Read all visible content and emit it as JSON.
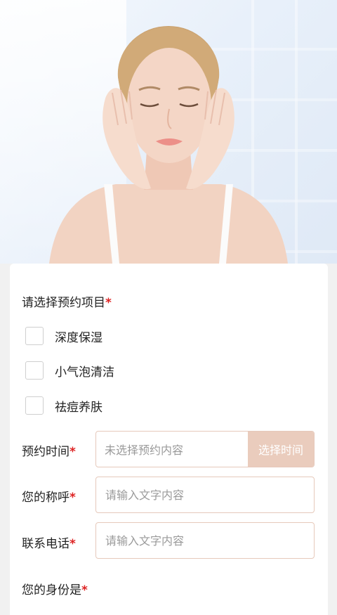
{
  "form": {
    "project_section_title": "请选择预约项目",
    "required_mark": "*",
    "options": [
      {
        "label": "深度保湿"
      },
      {
        "label": "小气泡清洁"
      },
      {
        "label": "祛痘养肤"
      }
    ],
    "time": {
      "label": "预约时间",
      "value_placeholder": "未选择预约内容",
      "pick_button": "选择时间"
    },
    "name": {
      "label": "您的称呼",
      "placeholder": "请输入文字内容"
    },
    "phone": {
      "label": "联系电话",
      "placeholder": "请输入文字内容"
    },
    "identity": {
      "label": "您的身份是"
    }
  },
  "colors": {
    "required": "#dd2222",
    "accent_field_border": "#e6c9bb",
    "pick_button_bg": "#eaccbd"
  }
}
